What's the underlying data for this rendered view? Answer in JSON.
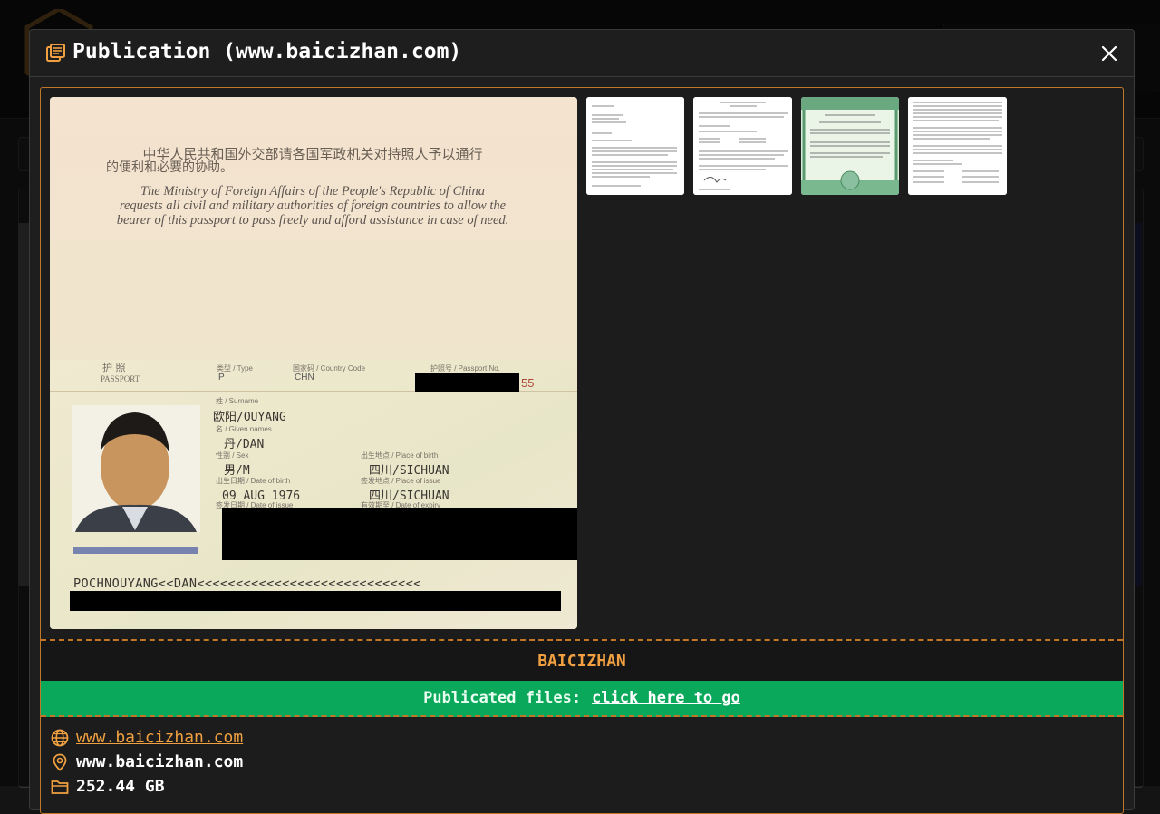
{
  "modal": {
    "title": "Publication (www.baicizhan.com)"
  },
  "publication": {
    "name": "BAICIZHAN",
    "files_label": "Publicated files:",
    "files_link": "click here to go",
    "website": "www.baicizhan.com",
    "location": "www.baicizhan.com",
    "size": "252.44 GB"
  },
  "passport": {
    "cn_line1": "中华人民共和国外交部请各国军政机关对持照人予以通行",
    "cn_line2": "的便利和必要的协助。",
    "en_line1": "The Ministry of Foreign Affairs of the People's Republic of China",
    "en_line2": "requests all civil and military authorities of foreign countries to allow the",
    "en_line3": "bearer of this passport to pass freely and afford assistance in case of need.",
    "label_passport_cn": "护 照",
    "label_passport_en": "PASSPORT",
    "label_type": "类型 / Type",
    "type_value": "P",
    "label_country": "国家码 / Country Code",
    "country_value": "CHN",
    "label_passport_no": "护照号 / Passport No.",
    "passport_no_tail": "55",
    "label_surname": "姓 / Surname",
    "surname": "欧阳/OUYANG",
    "label_given": "名 / Given names",
    "given": "丹/DAN",
    "label_sex": "性别 / Sex",
    "sex": "男/M",
    "label_pob": "出生地点 / Place of birth",
    "pob": "四川/SICHUAN",
    "label_dob": "出生日期 / Date of birth",
    "dob": "09 AUG 1976",
    "label_poi": "签发地点 / Place of issue",
    "poi": "四川/SICHUAN",
    "label_doi": "签发日期 / Date of issue",
    "label_doe": "有效期至 / Date of expiry",
    "mrz": "POCHNOUYANG<<DAN<<<<<<<<<<<<<<<<<<<<<<<<<<<<<"
  },
  "colors": {
    "accent": "#f0a040",
    "border": "#c07828",
    "green": "#0aa85a",
    "modal_bg": "#1e1e1e"
  },
  "icons": {
    "title": "books-icon",
    "close": "close-icon",
    "website": "globe-icon",
    "location": "map-pin-icon",
    "size": "folder-icon"
  }
}
